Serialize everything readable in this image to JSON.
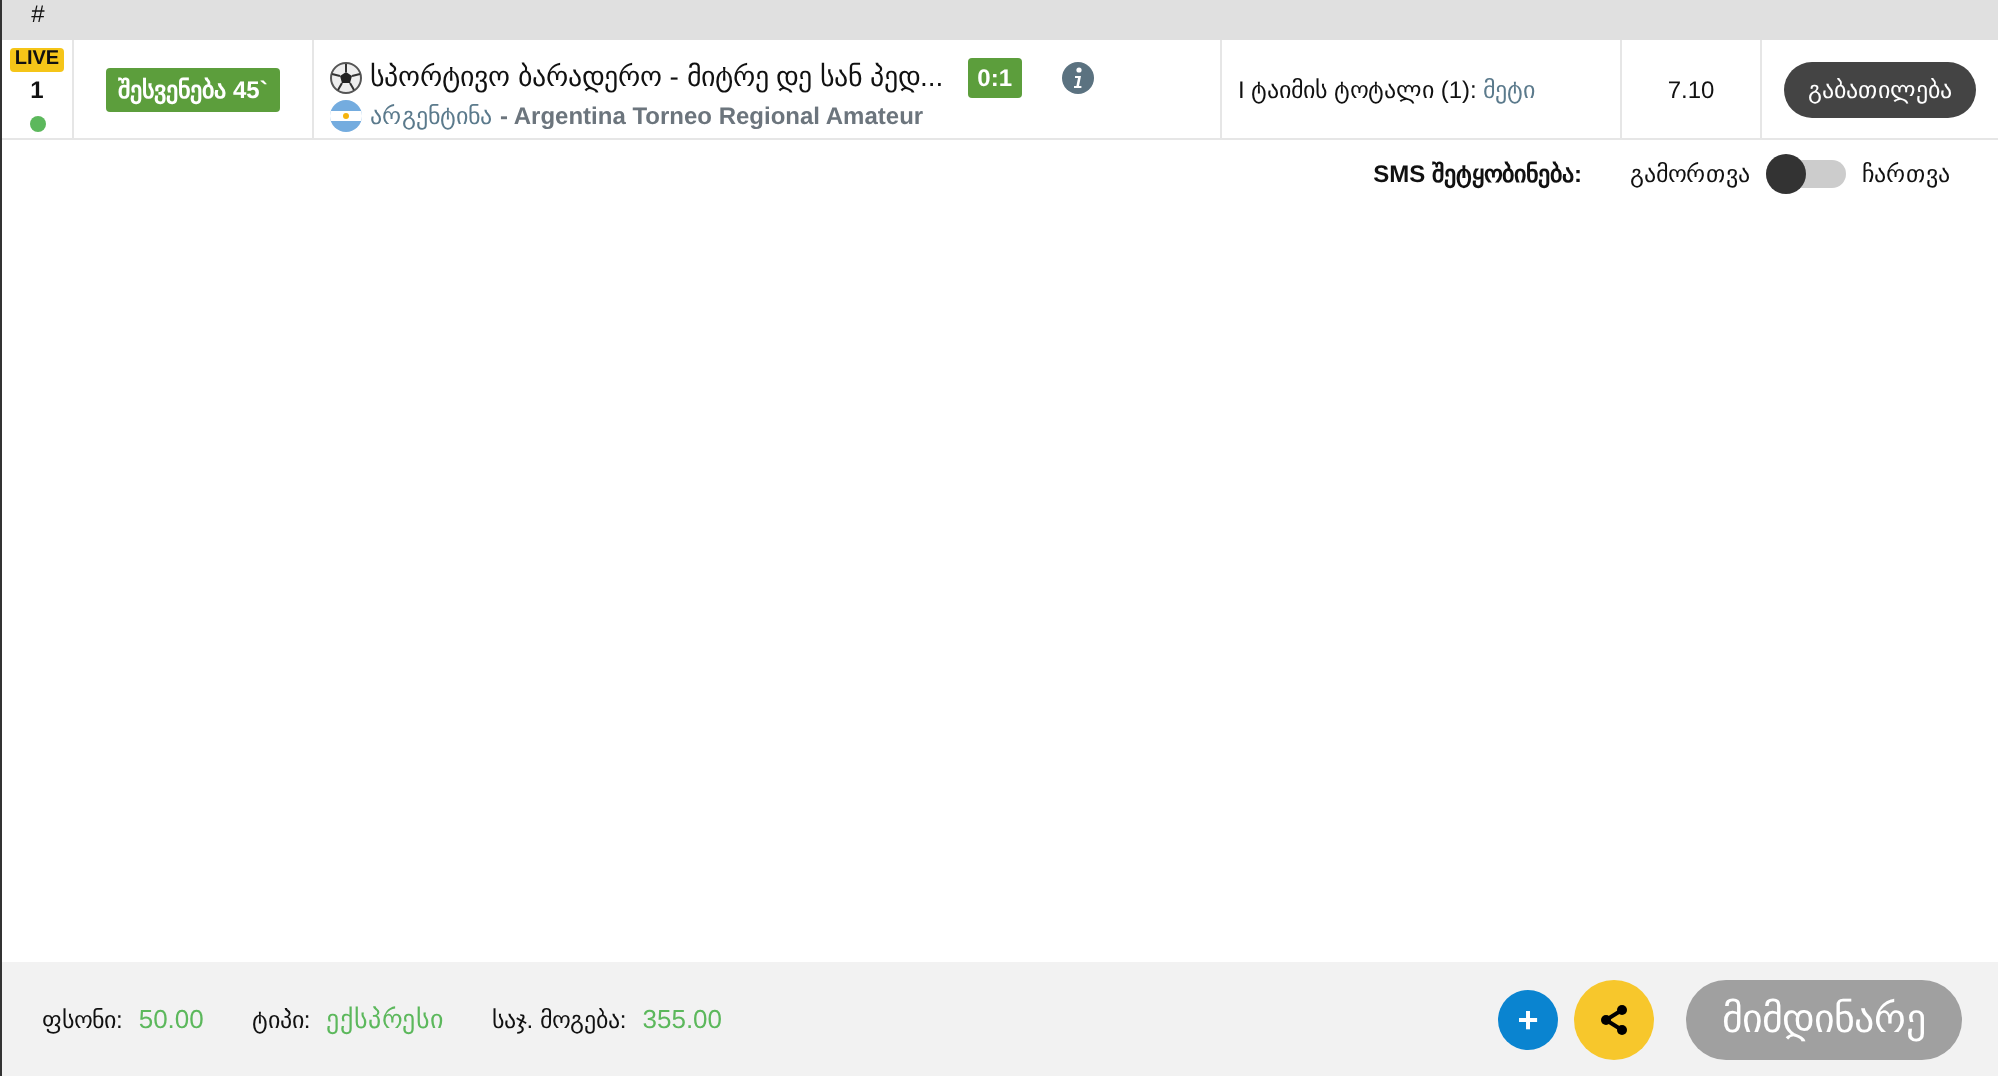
{
  "table": {
    "columns": [
      "#"
    ],
    "rows": [
      {
        "live_badge": "LIVE",
        "number": "1",
        "online": true,
        "status": "შესვენება 45`",
        "event": "სპორტივო ბარადერო - მიტრე დე სან პედ...",
        "score": "0:1",
        "country": "არგენტინა",
        "league": " - Argentina Torneo Regional Amateur",
        "market_label": "I ტაიმის ტოტალი (1): ",
        "market_value": "მეტი",
        "odds": "7.10",
        "action": "გაბათილება"
      }
    ]
  },
  "sms": {
    "label": "SMS შეტყობინება:",
    "off_label": "გამორთვა",
    "on": false,
    "on_label": "ჩართვა"
  },
  "footer": {
    "stake_label": "ფსონი:",
    "stake": "50.00",
    "type_label": "ტიპი:",
    "type": "ექსპრესი",
    "win_label": "საჯ. მოგება:",
    "win": "355.00",
    "add": "+",
    "current": "მიმდინარე"
  }
}
